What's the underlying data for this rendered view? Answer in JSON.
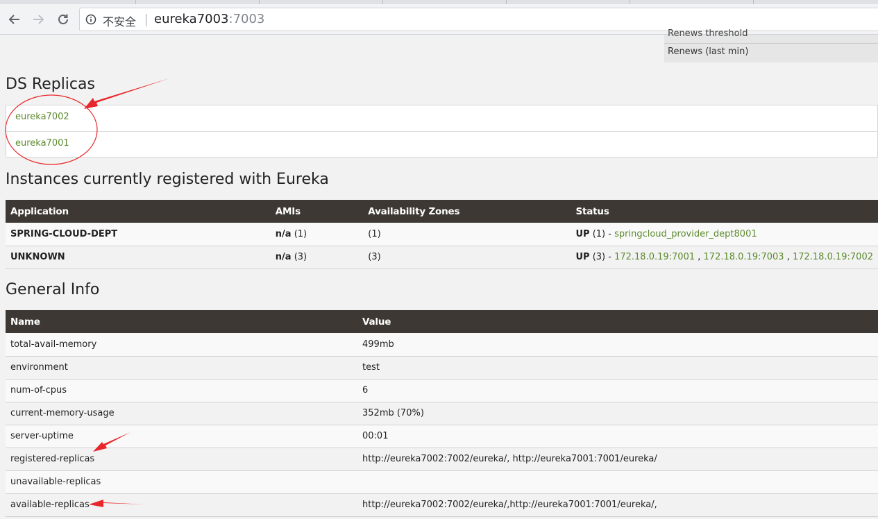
{
  "browser": {
    "security_label": "不安全",
    "url_host": "eureka7003",
    "url_port": ":7003"
  },
  "renews": {
    "threshold_label": "Renews threshold",
    "last_min_label": "Renews (last min)"
  },
  "ds_replicas": {
    "title": "DS Replicas",
    "items": [
      "eureka7002",
      "eureka7001"
    ]
  },
  "instances": {
    "title": "Instances currently registered with Eureka",
    "headers": [
      "Application",
      "AMIs",
      "Availability Zones",
      "Status"
    ],
    "rows": [
      {
        "application": "SPRING-CLOUD-DEPT",
        "amis_na": "n/a",
        "amis_count": " (1)",
        "zones": "(1)",
        "status_up": "UP",
        "status_count": " (1) - ",
        "links": [
          "springcloud_provider_dept8001"
        ]
      },
      {
        "application": "UNKNOWN",
        "amis_na": "n/a",
        "amis_count": " (3)",
        "zones": "(3)",
        "status_up": "UP",
        "status_count": " (3) - ",
        "links": [
          "172.18.0.19:7001",
          "172.18.0.19:7003",
          "172.18.0.19:7002"
        ]
      }
    ],
    "link_separator": " , "
  },
  "general_info": {
    "title": "General Info",
    "headers": [
      "Name",
      "Value"
    ],
    "rows": [
      {
        "name": "total-avail-memory",
        "value": "499mb"
      },
      {
        "name": "environment",
        "value": "test"
      },
      {
        "name": "num-of-cpus",
        "value": "6"
      },
      {
        "name": "current-memory-usage",
        "value": "352mb (70%)"
      },
      {
        "name": "server-uptime",
        "value": "00:01"
      },
      {
        "name": "registered-replicas",
        "value": "http://eureka7002:7002/eureka/, http://eureka7001:7001/eureka/"
      },
      {
        "name": "unavailable-replicas",
        "value": ""
      },
      {
        "name": "available-replicas",
        "value": "http://eureka7002:7002/eureka/,http://eureka7001:7001/eureka/,"
      }
    ]
  },
  "colors": {
    "header_bg": "#3d3833",
    "link_green": "#5c8a2e",
    "annotation_red": "#e8262b"
  }
}
